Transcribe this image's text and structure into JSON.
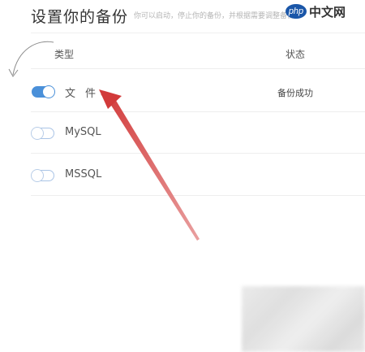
{
  "header": {
    "title": "设置你的备份",
    "subtitle": "你可以启动，停止你的备份，并根据需要调整备份时间",
    "watermark_badge": "php",
    "watermark_text": "中文网"
  },
  "table": {
    "columns": [
      "类型",
      "状态"
    ],
    "rows": [
      {
        "name": "文件",
        "enabled": true,
        "status": "备份成功"
      },
      {
        "name": "MySQL",
        "enabled": false,
        "status": ""
      },
      {
        "name": "MSSQL",
        "enabled": false,
        "status": ""
      }
    ]
  },
  "colors": {
    "toggle_on": "#4a90d9",
    "toggle_off_border": "#aac4e6",
    "annotation_arrow": "#d23a3a"
  },
  "icons": {
    "curved_arrow": "curved-arrow-annotation-icon",
    "pointer_arrow": "red-pointer-arrow-icon"
  }
}
